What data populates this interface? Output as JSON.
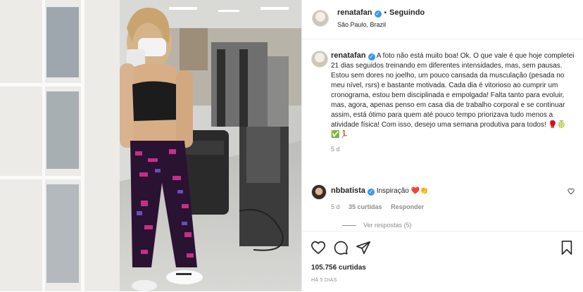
{
  "header": {
    "username": "renatafan",
    "separator": "•",
    "follow_status": "Seguindo",
    "location": "São Paulo, Brazil"
  },
  "caption": {
    "username": "renatafan",
    "text": "A foto não está muito boa! Ok. O que vale é que hoje completei 21 dias seguidos treinando em diferentes intensidades, mas, sem pausas. Estou sem dores no joelho, um pouco cansada da musculação (pesada no meu nível, rsrs) e bastante motivada. Cada dia é vitorioso ao cumprir um cronograma, estou bem disciplinada e empolgada! Falta tanto para evoluir, mas, agora, apenas penso em casa dia de trabalho corporal e se continuar assim, está ótimo para quem até pouco tempo priorizava tudo menos a atividade física! Com isso, desejo uma semana produtiva para todos! 🥊🍈",
    "emoji_line": "✅🏃",
    "age": "5 d"
  },
  "comment": {
    "username": "nbbatista",
    "text": "Inspiração ❤️👏",
    "age": "5 d",
    "likes": "35 curtidas",
    "reply_label": "Responder",
    "view_replies": "Ver respostas (5)"
  },
  "footer": {
    "likes": "105.756 curtidas",
    "timestamp": "HÁ 5 DIAS"
  },
  "icons": {
    "like": "heart-icon",
    "comment": "comment-icon",
    "share": "paper-plane-icon",
    "save": "bookmark-icon",
    "verified": "verified-badge-icon"
  },
  "colors": {
    "verified": "#3897f0",
    "secondary_text": "#8e8e8e",
    "border": "#efefef"
  }
}
